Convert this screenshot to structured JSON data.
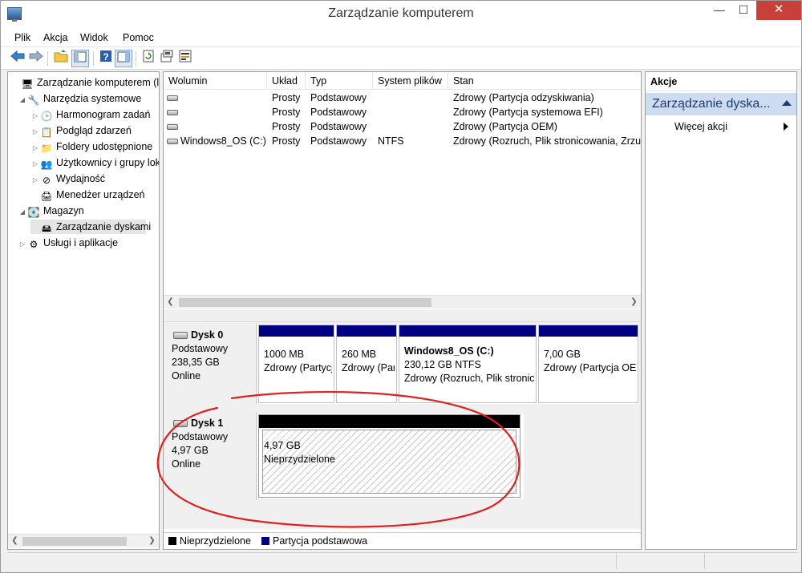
{
  "window": {
    "title": "Zarządzanie komputerem",
    "min_glyph": "—",
    "max_glyph": "☐",
    "close_glyph": "✕"
  },
  "menu": [
    "Plik",
    "Akcja",
    "Widok",
    "Pomoc"
  ],
  "toolbar": {
    "icons": [
      "back-arrow-icon",
      "forward-arrow-icon",
      "up-folder-icon",
      "show-hide-tree-icon",
      "help-icon",
      "properties-icon",
      "refresh-icon",
      "settings-icon",
      "disk-management-icon"
    ]
  },
  "tree": {
    "items": [
      {
        "label": "Zarządzanie komputerem (lokalne)",
        "arrow": "",
        "icon": "🖥",
        "level": 0
      },
      {
        "label": "Narzędzia systemowe",
        "arrow": "◢",
        "icon": "🔧",
        "level": 1
      },
      {
        "label": "Harmonogram zadań",
        "arrow": "▷",
        "icon": "🕒",
        "level": 2
      },
      {
        "label": "Podgląd zdarzeń",
        "arrow": "▷",
        "icon": "📋",
        "level": 2
      },
      {
        "label": "Foldery udostępnione",
        "arrow": "▷",
        "icon": "📁",
        "level": 2
      },
      {
        "label": "Użytkownicy i grupy lokalne",
        "arrow": "▷",
        "icon": "👥",
        "level": 2
      },
      {
        "label": "Wydajność",
        "arrow": "▷",
        "icon": "⊘",
        "level": 2
      },
      {
        "label": "Menedżer urządzeń",
        "arrow": "",
        "icon": "🖨",
        "level": 2
      },
      {
        "label": "Magazyn",
        "arrow": "◢",
        "icon": "💽",
        "level": 1
      },
      {
        "label": "Zarządzanie dyskami",
        "arrow": "",
        "icon": "🖴",
        "level": 2
      },
      {
        "label": "Usługi i aplikacje",
        "arrow": "▷",
        "icon": "⚙",
        "level": 1
      }
    ]
  },
  "volumes": {
    "columns": [
      "Wolumin",
      "Układ",
      "Typ",
      "System plików",
      "Stan"
    ],
    "rows": [
      [
        "",
        "Prosty",
        "Podstawowy",
        "",
        "Zdrowy (Partycja odzyskiwania)"
      ],
      [
        "",
        "Prosty",
        "Podstawowy",
        "",
        "Zdrowy (Partycja systemowa EFI)"
      ],
      [
        "",
        "Prosty",
        "Podstawowy",
        "",
        "Zdrowy (Partycja OEM)"
      ],
      [
        "Windows8_OS (C:)",
        "Prosty",
        "Podstawowy",
        "NTFS",
        "Zdrowy (Rozruch, Plik stronicowania, Zrzut awaryjny, Partycja podstawowa)"
      ]
    ]
  },
  "disks": [
    {
      "name": "Dysk 0",
      "type": "Podstawowy",
      "size": "238,35 GB",
      "status": "Online",
      "partitions": [
        {
          "title": "",
          "size": "1000 MB",
          "status": "Zdrowy (Partycja odzyskiwania)"
        },
        {
          "title": "",
          "size": "260 MB",
          "status": "Zdrowy (Partycja systemowa EFI)"
        },
        {
          "title": "Windows8_OS  (C:)",
          "size": "230,12 GB NTFS",
          "status": "Zdrowy (Rozruch, Plik stronicowania)"
        },
        {
          "title": "",
          "size": "7,00 GB",
          "status": "Zdrowy (Partycja OEM)"
        }
      ]
    },
    {
      "name": "Dysk 1",
      "type": "Podstawowy",
      "size": "4,97 GB",
      "status": "Online",
      "partitions": [
        {
          "title": "",
          "size": "4,97 GB",
          "status": "Nieprzydzielone"
        }
      ]
    }
  ],
  "legend": [
    {
      "label": "Nieprzydzielone",
      "color": "#000000"
    },
    {
      "label": "Partycja podstawowa",
      "color": "#000080"
    }
  ],
  "actions": {
    "header": "Akcje",
    "section": "Zarządzanie dyska...",
    "items": [
      "Więcej akcji"
    ]
  },
  "colors": {
    "primary_partition": "#000080",
    "unallocated": "#000000",
    "annotation": "#e02020",
    "selection": "#cddcf0"
  }
}
